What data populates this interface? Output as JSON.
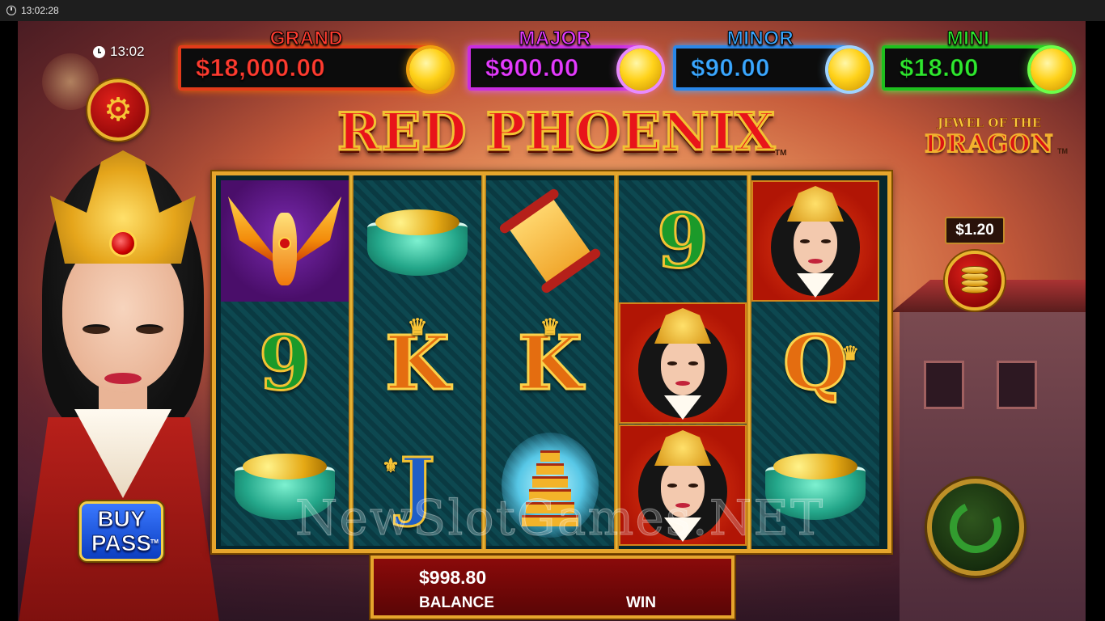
{
  "os_bar": {
    "time": "13:02:28",
    "icon": "clock-icon"
  },
  "game": {
    "clock": "13:02",
    "jackpots": [
      {
        "key": "grand",
        "label": "GRAND",
        "amount": "$18,000.00",
        "color": "#ff3b2f"
      },
      {
        "key": "major",
        "label": "MAJOR",
        "amount": "$900.00",
        "color": "#e53bff"
      },
      {
        "key": "minor",
        "label": "MINOR",
        "amount": "$90.00",
        "color": "#3aa7ff"
      },
      {
        "key": "mini",
        "label": "MINI",
        "amount": "$18.00",
        "color": "#2ee82e"
      }
    ],
    "title": "RED PHOENIX",
    "title_tm": "TM",
    "side_logo": {
      "small": "JEWEL OF THE",
      "big": "DRAGON",
      "tm": "TM"
    },
    "bet": "$1.20",
    "buy_pass": {
      "line1": "BUY",
      "line2": "PASS",
      "tm": "TM"
    },
    "balance": {
      "amount": "$998.80",
      "label": "BALANCE",
      "win_label": "WIN"
    },
    "watermark": "NewSlotGames.NET",
    "reels": [
      [
        "phoenix",
        "9",
        "bowl"
      ],
      [
        "bowl",
        "K",
        "J"
      ],
      [
        "scroll",
        "K",
        "pagoda"
      ],
      [
        "9",
        "empress",
        "empress"
      ],
      [
        "empress",
        "Q",
        "bowl"
      ]
    ]
  }
}
